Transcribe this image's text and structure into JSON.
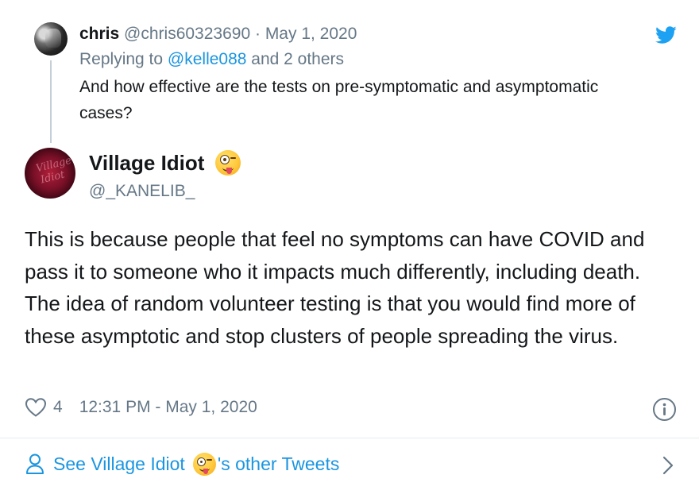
{
  "parent_tweet": {
    "display_name": "chris",
    "handle": "@chris60323690",
    "separator": " · ",
    "date": "May 1, 2020",
    "reply_prefix": "Replying to ",
    "reply_target": "@kelle088",
    "reply_suffix": " and 2 others",
    "text": "And how effective are the tests on pre-symptomatic and asymptomatic cases?",
    "avatar_icon": "avatar-photo"
  },
  "branding": {
    "logo_icon": "twitter-bird-icon",
    "logo_color": "#1da1f2"
  },
  "main_tweet": {
    "display_name": "Village Idiot",
    "name_emoji": "zany-face-emoji",
    "handle": "@_KANELIB_",
    "avatar_text_1": "Village",
    "avatar_text_2": "Idiot",
    "text": "This is because people that feel no symptoms can have COVID and pass it to someone who it impacts much differently, including death. The idea of random volunteer testing is that you would find more of these asymptotic and stop clusters of people spreading the virus.",
    "like_count": "4",
    "timestamp": "12:31 PM - May 1, 2020",
    "like_icon": "heart-icon",
    "info_icon": "info-icon"
  },
  "footer": {
    "link_prefix": "See Village Idiot ",
    "link_suffix": "'s other Tweets",
    "user_icon": "user-icon",
    "chevron_icon": "chevron-right-icon"
  },
  "colors": {
    "link_blue": "#1b95e0",
    "muted_gray": "#657786",
    "text_dark": "#14171a"
  }
}
